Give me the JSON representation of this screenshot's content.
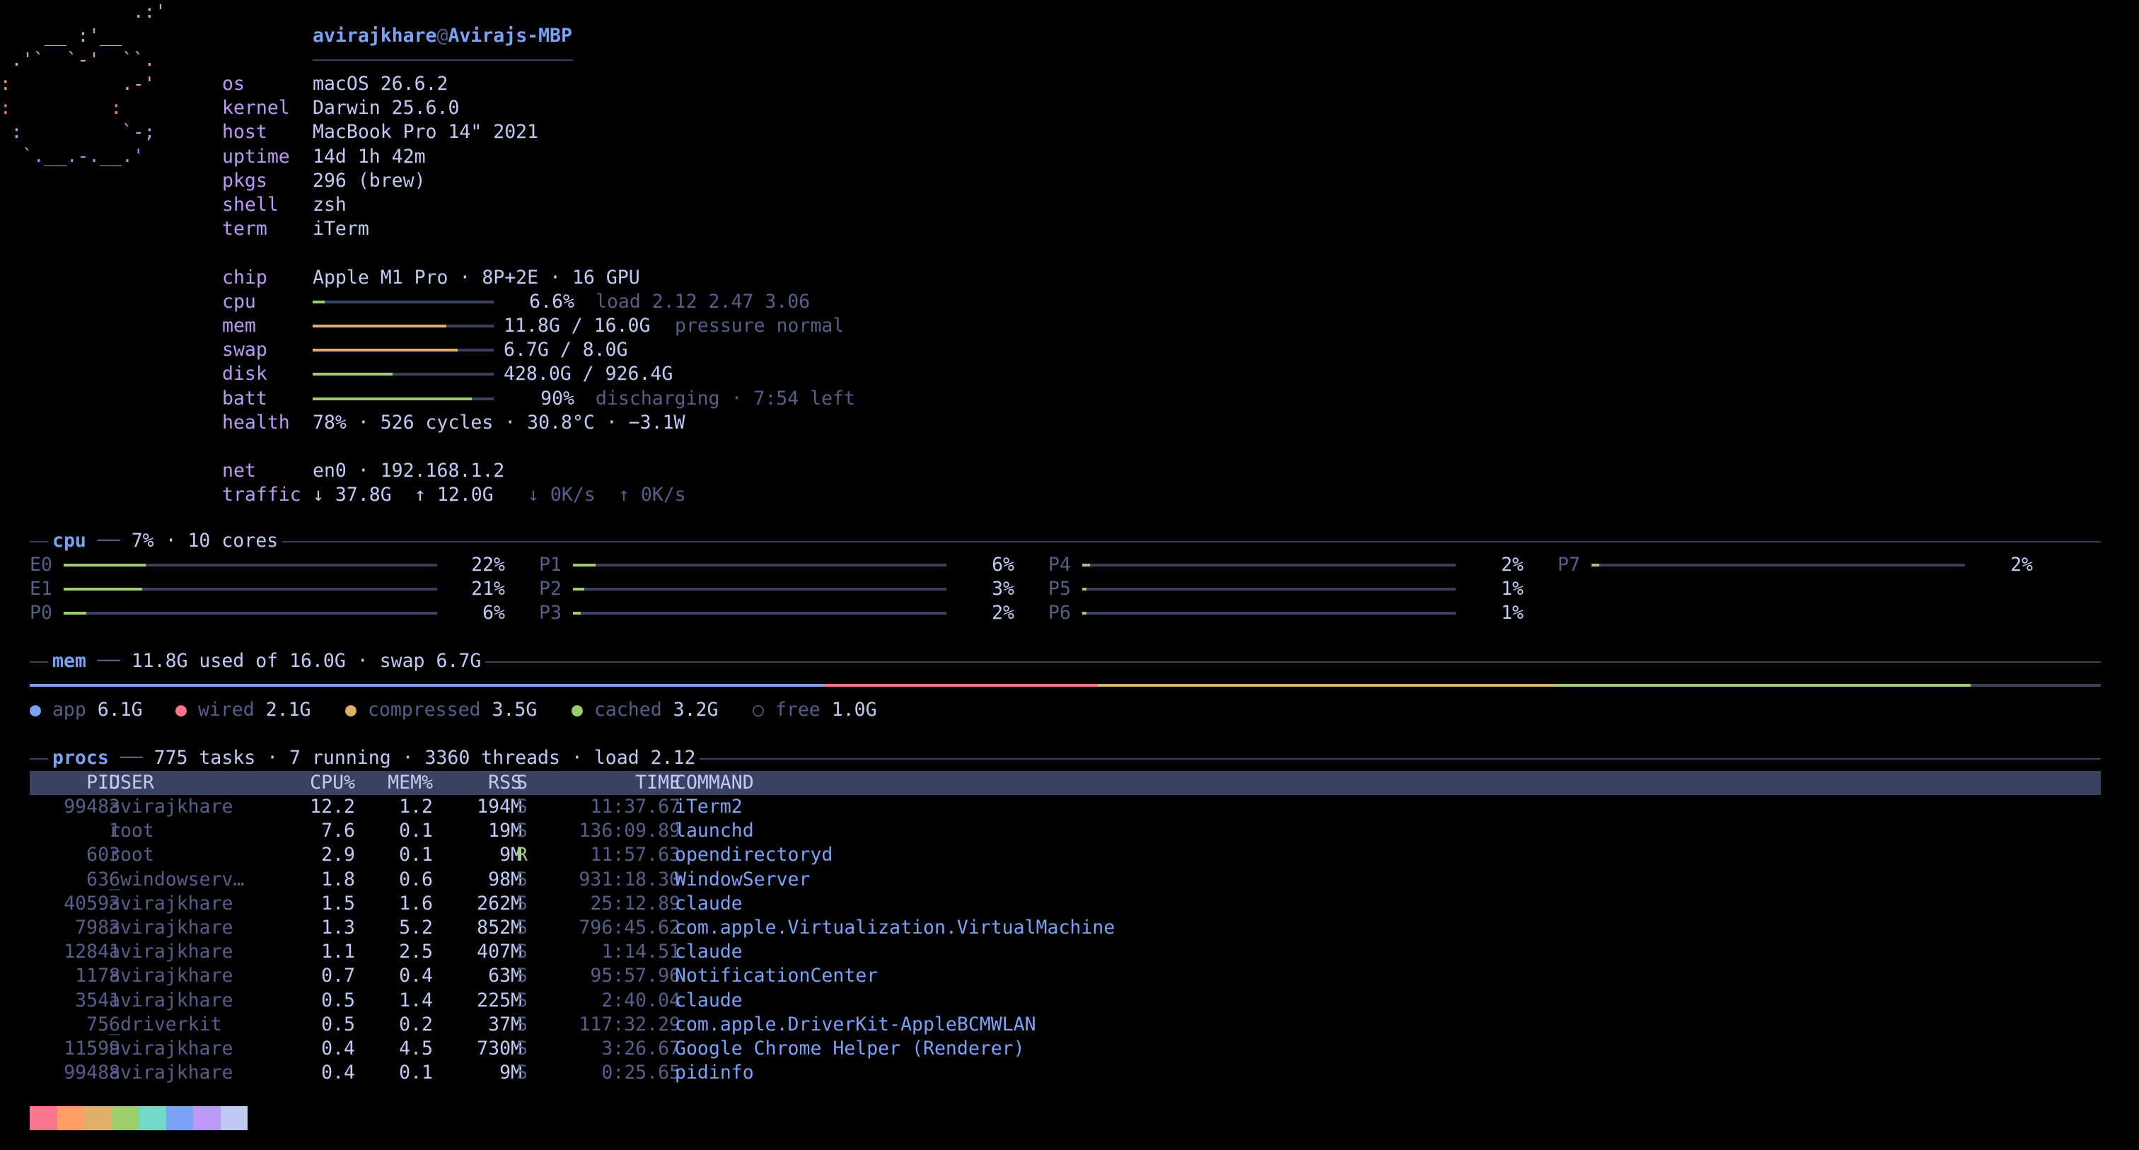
{
  "info": {
    "user": "avirajkhare",
    "at": "@",
    "host": "Avirajs-MBP",
    "rows": [
      {
        "label": "os",
        "value": "macOS 26.6.2"
      },
      {
        "label": "kernel",
        "value": "Darwin 25.6.0"
      },
      {
        "label": "host",
        "value": "MacBook Pro 14\" 2021"
      },
      {
        "label": "uptime",
        "value": "14d 1h 42m"
      },
      {
        "label": "pkgs",
        "value": "296 (brew)"
      },
      {
        "label": "shell",
        "value": "zsh"
      },
      {
        "label": "term",
        "value": "iTerm"
      }
    ],
    "chip": {
      "label": "chip",
      "value": "Apple M1 Pro · 8P+2E · 16 GPU"
    },
    "meters": [
      {
        "label": "cpu",
        "value": "6.6%",
        "extra": "load 2.12 2.47 3.06",
        "fraction": 0.066,
        "color": "#9ece6a"
      },
      {
        "label": "mem",
        "value": "11.8G / 16.0G",
        "extra": "pressure normal",
        "fraction": 0.74,
        "color": "#e0af68"
      },
      {
        "label": "swap",
        "value": "6.7G / 8.0G",
        "extra": "",
        "fraction": 0.8,
        "color": "#e0af68"
      },
      {
        "label": "disk",
        "value": "428.0G / 926.4G",
        "extra": "",
        "fraction": 0.44,
        "color": "#9ece6a"
      },
      {
        "label": "batt",
        "value": "90%",
        "extra": "discharging · 7:54 left",
        "fraction": 0.88,
        "color": "#9ece6a"
      }
    ],
    "health": {
      "label": "health",
      "value": "78% · 526 cycles · 30.8°C · −3.1W"
    },
    "net": {
      "label": "net",
      "value": "en0 · 192.168.1.2"
    },
    "traffic": {
      "label": "traffic",
      "down_total": "↓ 37.8G",
      "up_total": "↑ 12.0G",
      "down_rate": "↓ 0K/s",
      "up_rate": "↑ 0K/s"
    }
  },
  "cpu_section": {
    "title": "cpu",
    "summary": "7% · 10 cores",
    "cores": [
      {
        "name": "E0",
        "pct": "22%",
        "fraction": 0.22
      },
      {
        "name": "E1",
        "pct": "21%",
        "fraction": 0.21
      },
      {
        "name": "P0",
        "pct": "6%",
        "fraction": 0.06
      },
      {
        "name": "P1",
        "pct": "6%",
        "fraction": 0.06
      },
      {
        "name": "P2",
        "pct": "3%",
        "fraction": 0.03
      },
      {
        "name": "P3",
        "pct": "2%",
        "fraction": 0.02
      },
      {
        "name": "P4",
        "pct": "2%",
        "fraction": 0.02
      },
      {
        "name": "P5",
        "pct": "1%",
        "fraction": 0.01
      },
      {
        "name": "P6",
        "pct": "1%",
        "fraction": 0.01
      },
      {
        "name": "P7",
        "pct": "2%",
        "fraction": 0.02
      }
    ],
    "bar_color": "#9ece6a"
  },
  "mem_section": {
    "title": "mem",
    "summary": "11.8G used of 16.0G · swap 6.7G",
    "legend": [
      {
        "name": "app",
        "value": "6.1G",
        "color": "#7aa2f7",
        "marker": "●",
        "gb": 6.1
      },
      {
        "name": "wired",
        "value": "2.1G",
        "color": "#f7768e",
        "marker": "●",
        "gb": 2.1
      },
      {
        "name": "compressed",
        "value": "3.5G",
        "color": "#e0af68",
        "marker": "●",
        "gb": 3.5
      },
      {
        "name": "cached",
        "value": "3.2G",
        "color": "#9ece6a",
        "marker": "●",
        "gb": 3.2
      },
      {
        "name": "free",
        "value": "1.0G",
        "color": "#565f89",
        "marker": "○",
        "gb": 1.0
      }
    ]
  },
  "procs_section": {
    "title": "procs",
    "summary": "775 tasks · 7 running · 3360 threads · load 2.12",
    "columns": [
      "PID",
      "USER",
      "CPU%",
      "MEM%",
      "RSS",
      "S",
      "TIME",
      "COMMAND"
    ],
    "rows": [
      [
        "99483",
        "avirajkhare",
        "12.2",
        "1.2",
        "194M",
        "S",
        "11:37.67",
        "iTerm2"
      ],
      [
        "1",
        "root",
        "7.6",
        "0.1",
        "19M",
        "S",
        "136:09.89",
        "launchd"
      ],
      [
        "603",
        "root",
        "2.9",
        "0.1",
        "9M",
        "R",
        "11:57.63",
        "opendirectoryd"
      ],
      [
        "636",
        "_windowserv…",
        "1.8",
        "0.6",
        "98M",
        "S",
        "931:18.30",
        "WindowServer"
      ],
      [
        "40593",
        "avirajkhare",
        "1.5",
        "1.6",
        "262M",
        "S",
        "25:12.89",
        "claude"
      ],
      [
        "7983",
        "avirajkhare",
        "1.3",
        "5.2",
        "852M",
        "S",
        "796:45.62",
        "com.apple.Virtualization.VirtualMachine"
      ],
      [
        "12841",
        "avirajkhare",
        "1.1",
        "2.5",
        "407M",
        "S",
        "1:14.51",
        "claude"
      ],
      [
        "1178",
        "avirajkhare",
        "0.7",
        "0.4",
        "63M",
        "S",
        "95:57.96",
        "NotificationCenter"
      ],
      [
        "3541",
        "avirajkhare",
        "0.5",
        "1.4",
        "225M",
        "S",
        "2:40.04",
        "claude"
      ],
      [
        "756",
        "_driverkit",
        "0.5",
        "0.2",
        "37M",
        "S",
        "117:32.29",
        "com.apple.DriverKit-AppleBCMWLAN"
      ],
      [
        "11599",
        "avirajkhare",
        "0.4",
        "4.5",
        "730M",
        "S",
        "3:26.67",
        "Google Chrome Helper (Renderer)"
      ],
      [
        "99488",
        "avirajkhare",
        "0.4",
        "0.1",
        "9M",
        "S",
        "0:25.65",
        "pidinfo"
      ]
    ]
  },
  "palette": [
    "#f7768e",
    "#ff9e64",
    "#e0af68",
    "#9ece6a",
    "#73daca",
    "#7aa2f7",
    "#bb9af7",
    "#c0caf5"
  ],
  "colors": {
    "background": "#000000",
    "label": "#bb9af7",
    "text": "#c0caf5",
    "dim": "#565f89",
    "accent": "#7aa2f7",
    "track": "#3b4261"
  }
}
